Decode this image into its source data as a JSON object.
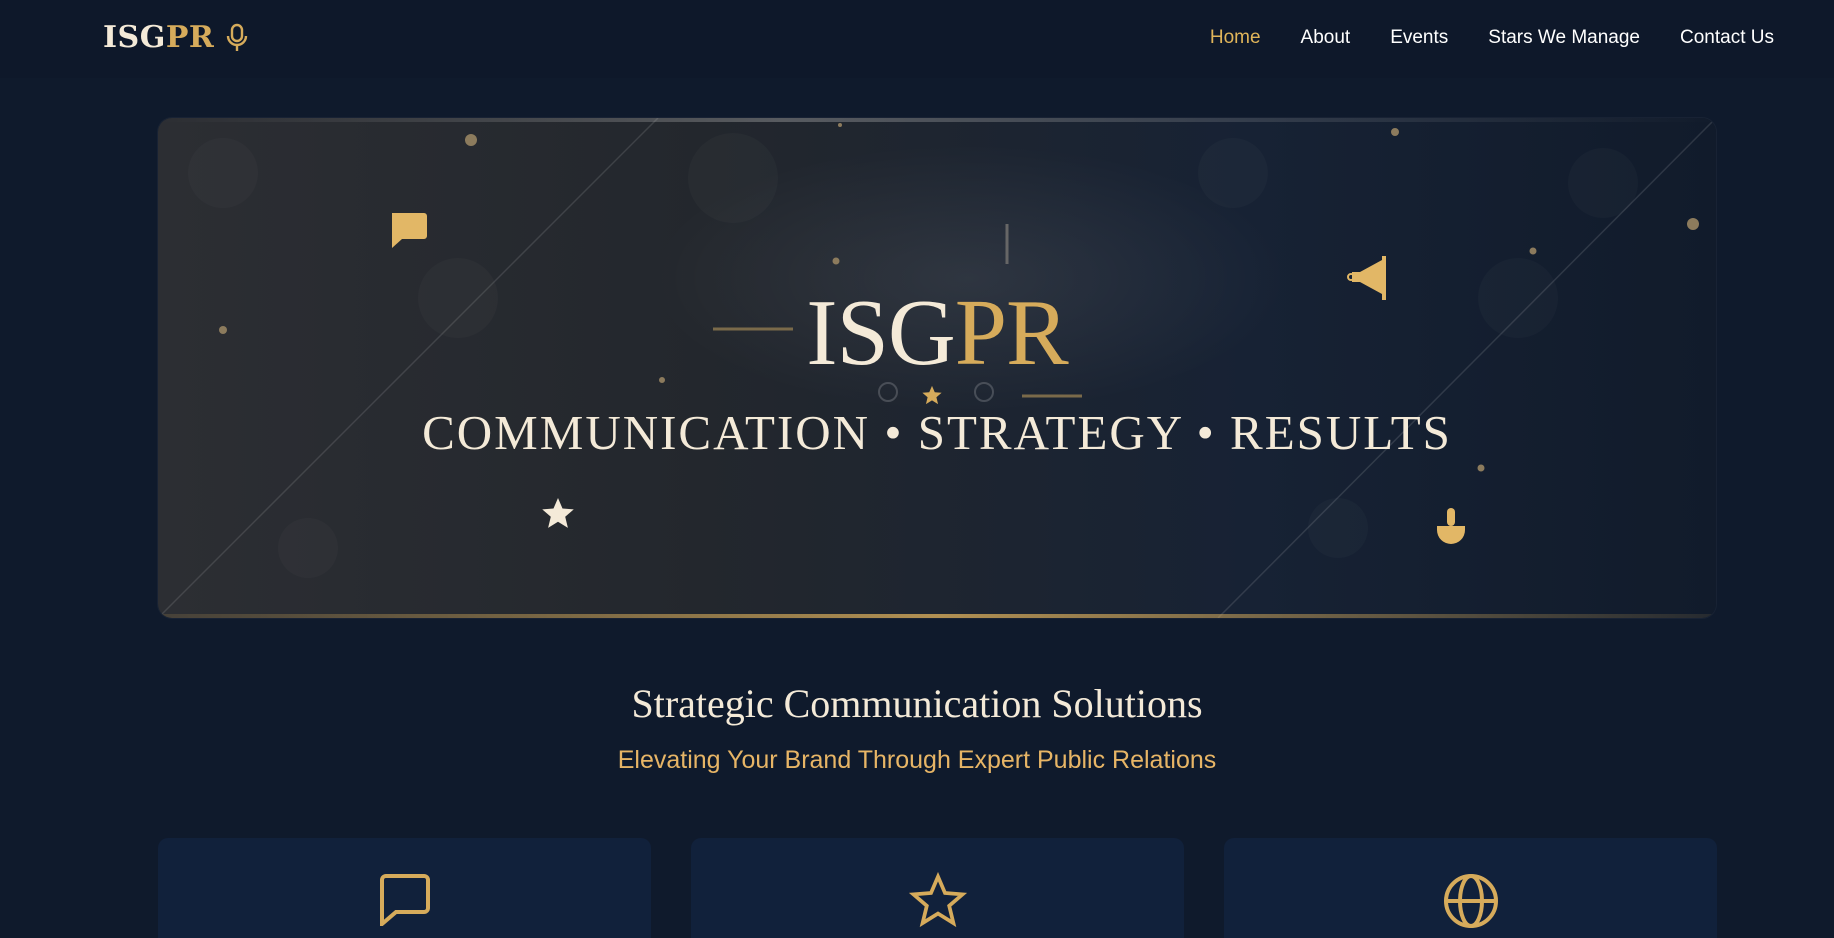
{
  "brand": {
    "isg": "ISG",
    "pr": "PR",
    "icon": "microphone-icon"
  },
  "nav": {
    "items": [
      {
        "label": "Home",
        "active": true
      },
      {
        "label": "About",
        "active": false
      },
      {
        "label": "Events",
        "active": false
      },
      {
        "label": "Stars We Manage",
        "active": false
      },
      {
        "label": "Contact Us",
        "active": false
      }
    ]
  },
  "hero": {
    "title_isg": "ISG",
    "title_pr": "PR",
    "tagline": "COMMUNICATION • STRATEGY • RESULTS",
    "icons": [
      "chat-bubble-icon",
      "megaphone-icon",
      "star-icon",
      "thumb-icon"
    ]
  },
  "section": {
    "title": "Strategic Communication Solutions",
    "subtitle": "Elevating Your Brand Through Expert Public Relations"
  },
  "cards": [
    {
      "icon": "chat-bubble-icon"
    },
    {
      "icon": "star-icon"
    },
    {
      "icon": "globe-icon"
    }
  ],
  "colors": {
    "accent": "#d6ab5b",
    "background": "#0f1a2c",
    "text": "#f4ead8",
    "card": "#11213b"
  }
}
